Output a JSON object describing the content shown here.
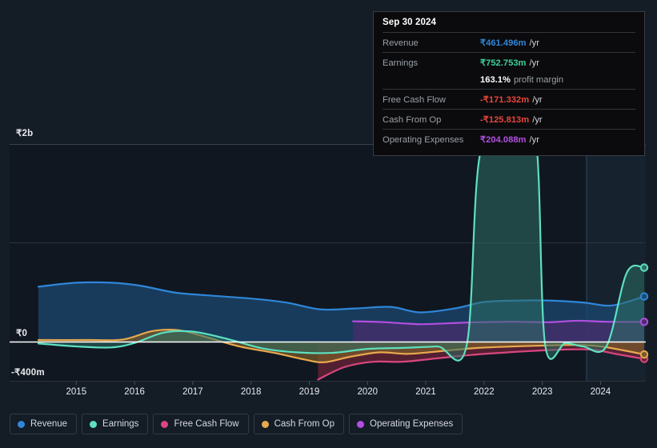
{
  "chart_data": {
    "type": "area",
    "title": "",
    "xlabel": "",
    "ylabel": "",
    "currency": "₹",
    "ylim": [
      -400000000,
      2000000000
    ],
    "y_ticks": [
      {
        "label": "₹2b",
        "value": 2000000000
      },
      {
        "label": "₹0",
        "value": 0
      },
      {
        "label": "-₹400m",
        "value": -400000000
      }
    ],
    "grid": true,
    "legend_position": "bottom",
    "x_ticks": [
      "2015",
      "2016",
      "2017",
      "2018",
      "2019",
      "2020",
      "2021",
      "2022",
      "2023",
      "2024"
    ],
    "forecast_band_start": "2023.7",
    "series": [
      {
        "name": "Revenue",
        "color": "#2f86d8",
        "fill": "#1c4a73",
        "end_value_label": "₹461.496m",
        "points": [
          [
            2014.35,
            560
          ],
          [
            2015.0,
            600
          ],
          [
            2015.6,
            600
          ],
          [
            2016.1,
            570
          ],
          [
            2016.7,
            500
          ],
          [
            2017.3,
            470
          ],
          [
            2018.0,
            440
          ],
          [
            2018.6,
            400
          ],
          [
            2019.2,
            330
          ],
          [
            2019.8,
            340
          ],
          [
            2020.4,
            355
          ],
          [
            2020.9,
            300
          ],
          [
            2021.5,
            340
          ],
          [
            2022.0,
            405
          ],
          [
            2022.6,
            420
          ],
          [
            2023.1,
            420
          ],
          [
            2023.7,
            400
          ],
          [
            2024.2,
            370
          ],
          [
            2024.75,
            461
          ]
        ]
      },
      {
        "name": "Earnings",
        "color": "#5de0c0",
        "fill": "#2e6f64",
        "end_value_label": "₹752.753m",
        "points": [
          [
            2014.35,
            -15
          ],
          [
            2015.0,
            -45
          ],
          [
            2015.6,
            -55
          ],
          [
            2016.0,
            -10
          ],
          [
            2016.5,
            95
          ],
          [
            2017.0,
            105
          ],
          [
            2017.6,
            30
          ],
          [
            2018.2,
            -65
          ],
          [
            2018.8,
            -105
          ],
          [
            2019.4,
            -110
          ],
          [
            2020.0,
            -70
          ],
          [
            2020.6,
            -60
          ],
          [
            2021.2,
            -45
          ],
          [
            2021.7,
            -40
          ],
          [
            2021.95,
            1950
          ],
          [
            2022.6,
            1960
          ],
          [
            2022.9,
            1990
          ],
          [
            2023.05,
            -30
          ],
          [
            2023.4,
            -10
          ],
          [
            2023.7,
            -45
          ],
          [
            2024.1,
            -45
          ],
          [
            2024.45,
            700
          ],
          [
            2024.75,
            753
          ]
        ]
      },
      {
        "name": "Free Cash Flow",
        "color": "#d9467f",
        "fill": "#6e2438",
        "end_value_label": "-₹171.332m",
        "points": [
          [
            2019.15,
            -380
          ],
          [
            2019.6,
            -255
          ],
          [
            2020.1,
            -200
          ],
          [
            2020.6,
            -200
          ],
          [
            2021.2,
            -165
          ],
          [
            2021.8,
            -130
          ],
          [
            2022.4,
            -105
          ],
          [
            2023.0,
            -85
          ],
          [
            2023.5,
            -75
          ],
          [
            2023.9,
            -80
          ],
          [
            2024.3,
            -125
          ],
          [
            2024.75,
            -171
          ]
        ]
      },
      {
        "name": "Cash From Op",
        "color": "#e8a94e",
        "fill": "#7a5a2a",
        "end_value_label": "-₹125.813m",
        "points": [
          [
            2014.35,
            20
          ],
          [
            2015.2,
            20
          ],
          [
            2015.8,
            25
          ],
          [
            2016.3,
            110
          ],
          [
            2016.75,
            120
          ],
          [
            2017.2,
            55
          ],
          [
            2017.8,
            -45
          ],
          [
            2018.4,
            -110
          ],
          [
            2018.9,
            -175
          ],
          [
            2019.25,
            -205
          ],
          [
            2019.7,
            -150
          ],
          [
            2020.2,
            -105
          ],
          [
            2020.7,
            -120
          ],
          [
            2021.3,
            -90
          ],
          [
            2021.9,
            -60
          ],
          [
            2022.5,
            -45
          ],
          [
            2023.1,
            -35
          ],
          [
            2023.6,
            -30
          ],
          [
            2024.0,
            -45
          ],
          [
            2024.4,
            -85
          ],
          [
            2024.75,
            -126
          ]
        ]
      },
      {
        "name": "Operating Expenses",
        "color": "#b24fe0",
        "fill": "#4a2d6e",
        "end_value_label": "₹204.088m",
        "points": [
          [
            2019.75,
            210
          ],
          [
            2020.3,
            200
          ],
          [
            2020.9,
            180
          ],
          [
            2021.4,
            190
          ],
          [
            2021.9,
            200
          ],
          [
            2022.5,
            205
          ],
          [
            2023.1,
            200
          ],
          [
            2023.6,
            215
          ],
          [
            2024.1,
            205
          ],
          [
            2024.75,
            204
          ]
        ]
      }
    ]
  },
  "tooltip": {
    "date": "Sep 30 2024",
    "unit": "/yr",
    "rows": [
      {
        "label": "Revenue",
        "value": "₹461.496m",
        "color": "#2f86d8"
      },
      {
        "label": "Earnings",
        "value": "₹752.753m",
        "color": "#3ecf9a"
      },
      {
        "label": "Free Cash Flow",
        "value": "-₹171.332m",
        "color": "#e8453c"
      },
      {
        "label": "Cash From Op",
        "value": "-₹125.813m",
        "color": "#e8453c"
      },
      {
        "label": "Operating Expenses",
        "value": "₹204.088m",
        "color": "#b24fe0"
      }
    ],
    "profit_margin_value": "163.1%",
    "profit_margin_text": "profit margin"
  },
  "legend": {
    "items": [
      {
        "label": "Revenue",
        "color": "#2f86d8"
      },
      {
        "label": "Earnings",
        "color": "#5de0c0"
      },
      {
        "label": "Free Cash Flow",
        "color": "#d9467f"
      },
      {
        "label": "Cash From Op",
        "color": "#e8a94e"
      },
      {
        "label": "Operating Expenses",
        "color": "#b24fe0"
      }
    ]
  },
  "axis": {
    "y_top": "₹2b",
    "y_zero": "₹0",
    "y_neg": "-₹400m",
    "x_ticks": [
      "2015",
      "2016",
      "2017",
      "2018",
      "2019",
      "2020",
      "2021",
      "2022",
      "2023",
      "2024"
    ]
  }
}
